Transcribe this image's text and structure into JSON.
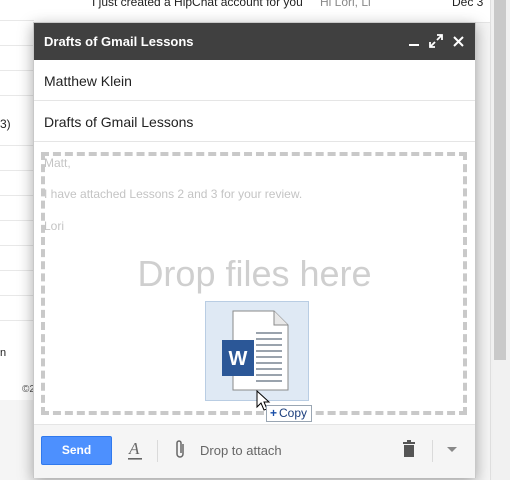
{
  "background": {
    "inbox_row": {
      "subject": "I just created a HipChat account for you",
      "snippet": "Hi Lori, Li",
      "date": "Dec 3"
    },
    "left_fragment": "3)",
    "left_fragment_2": "n",
    "left_footer": "©2"
  },
  "compose": {
    "title": "Drafts of Gmail Lessons",
    "to": "Matthew Klein",
    "subject": "Drafts of Gmail Lessons",
    "body_lines": [
      "Matt,",
      "I have attached Lessons 2 and 3 for your review.",
      "Lori"
    ],
    "drop_zone_text": "Drop files here",
    "drag_tooltip": "Copy",
    "drag_file_icon": "word-document-icon",
    "toolbar": {
      "send_label": "Send",
      "drop_to_attach_label": "Drop to attach",
      "format_icon": "formatting-icon",
      "attach_icon": "paperclip-icon",
      "trash_icon": "trash-icon",
      "more_icon": "chevron-down-icon"
    },
    "colors": {
      "titlebar": "#404040",
      "send_button": "#4d90fe",
      "word_blue": "#2b5797"
    }
  }
}
